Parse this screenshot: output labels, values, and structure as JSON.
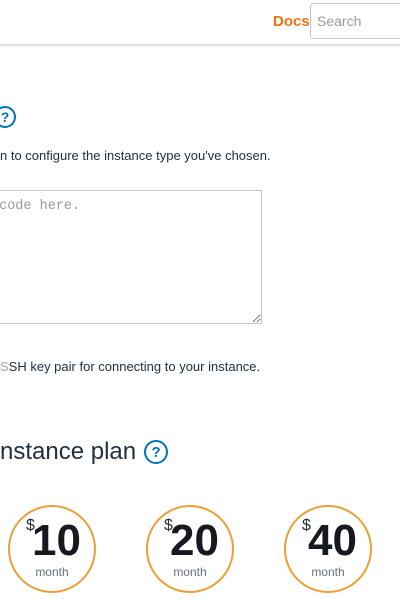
{
  "header": {
    "docs_label": "Docs",
    "search_placeholder": "Search"
  },
  "launch_script": {
    "help_symbol": "?",
    "description": "n to configure the instance type you've chosen.",
    "code_placeholder": " code here."
  },
  "ssh_key": {
    "description_prefix": "S",
    "description_rest": "SH key pair for connecting to your instance."
  },
  "instance_plan": {
    "heading": "nstance plan",
    "help_symbol": "?",
    "currency_symbol": "$",
    "period_label": "month",
    "plans": [
      {
        "price": "10"
      },
      {
        "price": "20"
      },
      {
        "price": "40"
      }
    ]
  },
  "colors": {
    "accent_orange": "#ec7211",
    "plan_border": "#ec9f36",
    "help_blue": "#0073bb"
  }
}
